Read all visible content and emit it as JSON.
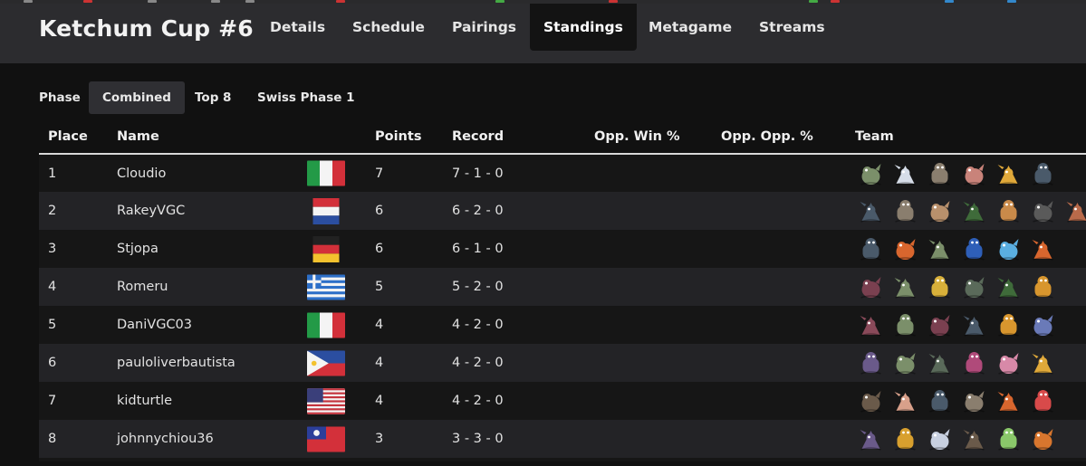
{
  "header": {
    "title": "Ketchum Cup #6",
    "tabs": [
      {
        "label": "Details"
      },
      {
        "label": "Schedule"
      },
      {
        "label": "Pairings"
      },
      {
        "label": "Standings",
        "active": true
      },
      {
        "label": "Metagame"
      },
      {
        "label": "Streams"
      }
    ]
  },
  "phase": {
    "label": "Phase",
    "options": [
      {
        "label": "Combined",
        "active": true
      },
      {
        "label": "Top 8"
      },
      {
        "label": "Swiss Phase 1"
      }
    ]
  },
  "standings": {
    "columns": [
      "Place",
      "Name",
      "",
      "Points",
      "Record",
      "Opp. Win %",
      "Opp. Opp. %",
      "Team"
    ],
    "rows": [
      {
        "place": "1",
        "name": "Cloudio",
        "flag": "italy",
        "points": "7",
        "record": "7 - 1 - 0",
        "team": [
          "#7b8f6a",
          "#d6dde8",
          "#8a7e6e",
          "#c9837a",
          "#e0a93a",
          "#4a5a6a"
        ]
      },
      {
        "place": "2",
        "name": "RakeyVGC",
        "flag": "netherlands",
        "points": "6",
        "record": "6 - 2 - 0",
        "team": [
          "#4a5a6a",
          "#8a7e6e",
          "#b8906c",
          "#3f6b3a",
          "#c98a4a",
          "#5a5a5a",
          "#b86a4a"
        ]
      },
      {
        "place": "3",
        "name": "Stjopa",
        "flag": "germany",
        "points": "6",
        "record": "6 - 1 - 0",
        "team": [
          "#4a5a6a",
          "#d8662e",
          "#7b8f6a",
          "#2e5fb8",
          "#5aaee0",
          "#d8662e"
        ]
      },
      {
        "place": "4",
        "name": "Romeru",
        "flag": "greece",
        "points": "5",
        "record": "5 - 2 - 0",
        "team": [
          "#7a4050",
          "#7b8f6a",
          "#d8b03a",
          "#5a6a5a",
          "#3f6b3a",
          "#d8962e"
        ]
      },
      {
        "place": "5",
        "name": "DaniVGC03",
        "flag": "italy",
        "points": "4",
        "record": "4 - 2 - 0",
        "team": [
          "#8a4a5a",
          "#7b8f6a",
          "#7a4050",
          "#4a5a6a",
          "#d8962e",
          "#6a7ab8"
        ]
      },
      {
        "place": "6",
        "name": "pauloliverbautista",
        "flag": "philippines",
        "points": "4",
        "record": "4 - 2 - 0",
        "team": [
          "#6a5a8a",
          "#7b8f6a",
          "#5a6a5a",
          "#b04a7a",
          "#d889a8",
          "#e0a93a"
        ]
      },
      {
        "place": "7",
        "name": "kidturtle",
        "flag": "usa",
        "points": "4",
        "record": "4 - 2 - 0",
        "team": [
          "#6a5a4a",
          "#d8a08a",
          "#4a5a6a",
          "#8a7e6e",
          "#d8662e",
          "#d84a4a"
        ]
      },
      {
        "place": "8",
        "name": "johnnychiou36",
        "flag": "taiwan",
        "points": "3",
        "record": "3 - 3 - 0",
        "team": [
          "#6a5a8a",
          "#d8a02e",
          "#c8d0e0",
          "#6a5a4a",
          "#8ac86a",
          "#d8762e"
        ]
      }
    ]
  },
  "colors": {
    "header_bg": "#2c2c2f",
    "page_bg": "#111111",
    "row_alt": "#232326"
  }
}
